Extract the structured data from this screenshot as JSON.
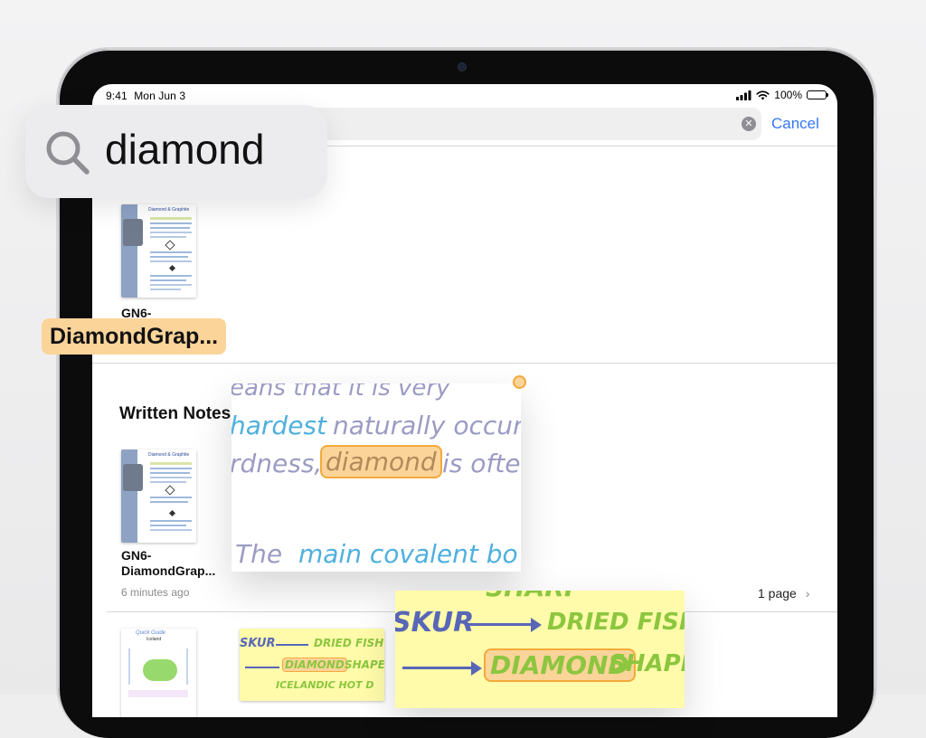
{
  "status_bar": {
    "time": "9:41",
    "date": "Mon Jun 3",
    "battery_percent": "100%"
  },
  "search": {
    "query": "diamond",
    "cancel_label": "Cancel"
  },
  "top_result": {
    "title_line1": "GN6-",
    "title_line2_highlighted": "DiamondGrap..."
  },
  "written_notes": {
    "section_title": "Written Notes",
    "result": {
      "title_line1": "GN6-",
      "title_line2": "DiamondGrap...",
      "time_ago": "6 minutes ago",
      "page_count": "1 page"
    }
  },
  "zoom_handwriting": {
    "line1": "eans that it is very",
    "line2_a": "hardest",
    "line2_b": "naturally occur",
    "line3_a": "rdness,",
    "line3_match": "diamond",
    "line3_b": "is ofte",
    "line4_a": "The",
    "line4_b": "main covalent bo"
  },
  "zoom_sticky": {
    "top": "SHARP",
    "row1_left": "SKUR",
    "row1_right": "DRIED FISH",
    "row2_match": "DIAMOND",
    "row2_right": "SHAPE"
  },
  "small_sticky": {
    "row1_left": "SKUR",
    "row1_right": "DRIED FISH",
    "row2_match": "DIAMOND",
    "row2_right": "SHAPE",
    "row3": "ICELANDIC HOT D"
  },
  "quick_guide": {
    "title_line1": "Quick Guide",
    "title_line2": "Iceland"
  },
  "doc_thumb": {
    "heading": "Diamond & Graphite"
  },
  "colors": {
    "accent": "#3478f6",
    "highlight_fill": "#fbd49a",
    "highlight_border": "#f3a93b",
    "sticky_yellow": "#fffbaa"
  }
}
